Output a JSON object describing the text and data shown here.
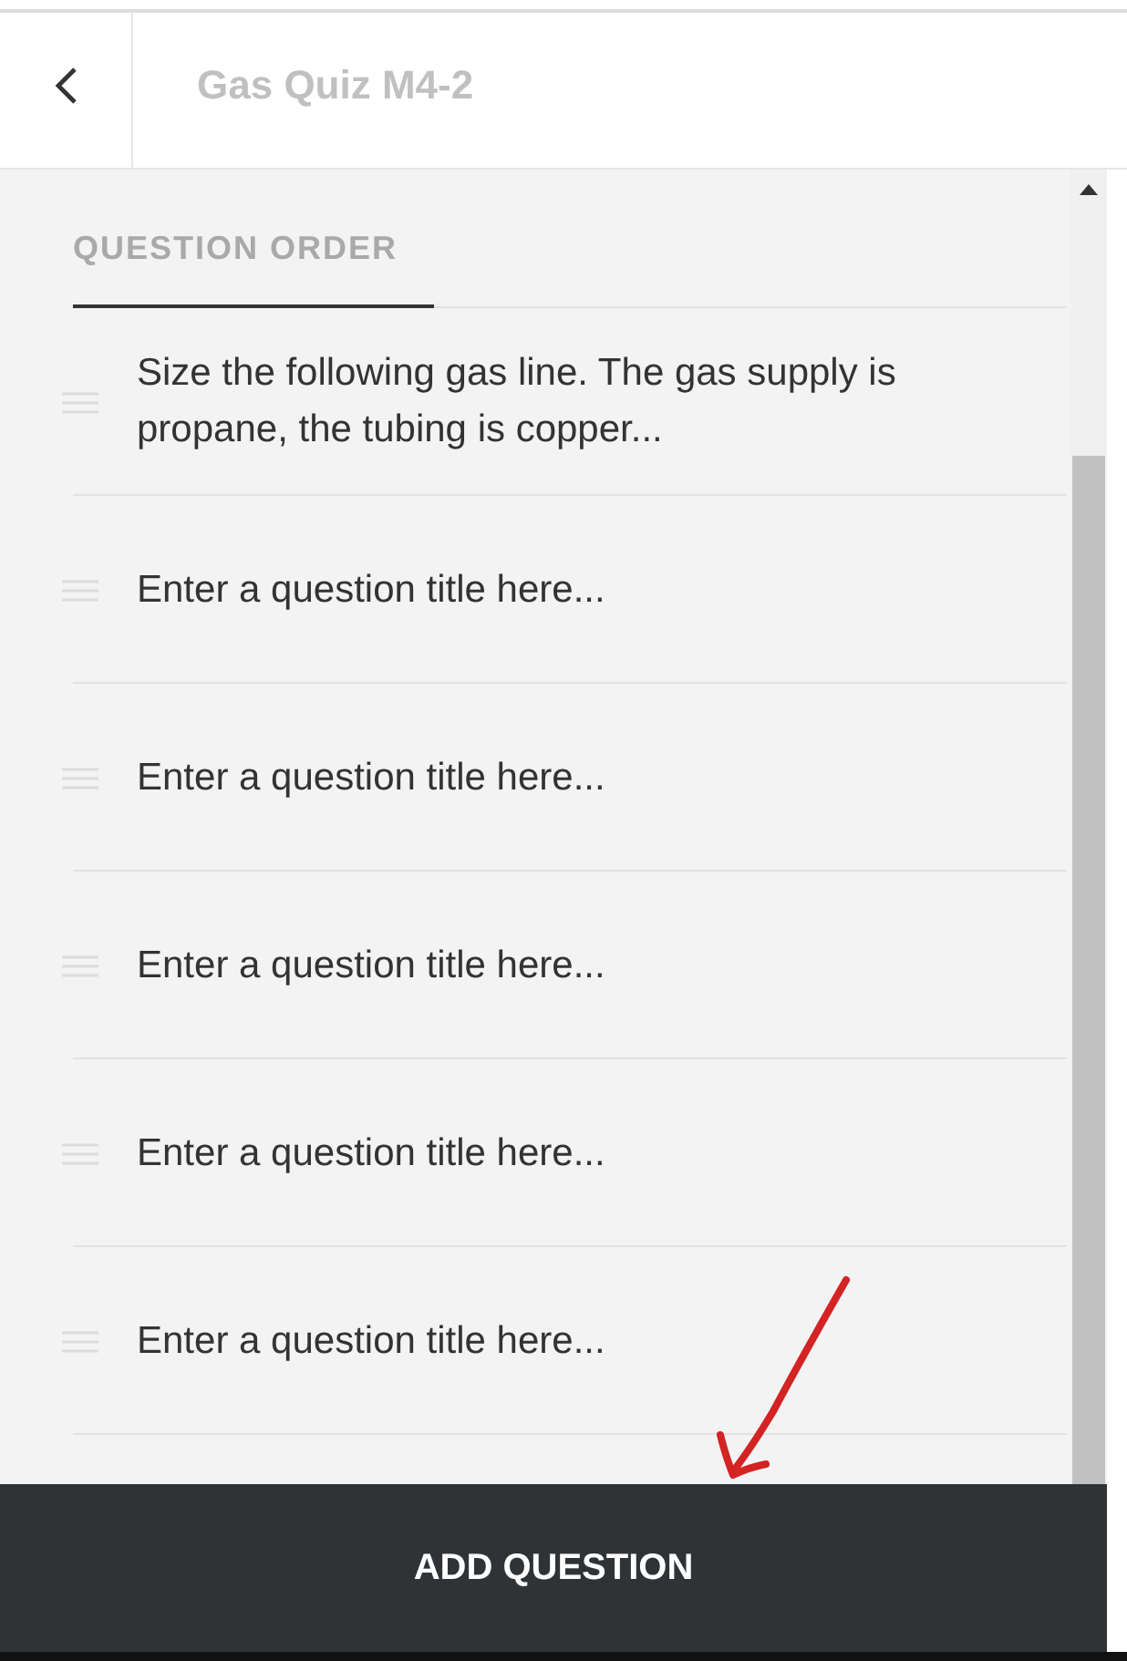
{
  "header": {
    "title": "Gas Quiz M4-2"
  },
  "section": {
    "heading": "QUESTION ORDER"
  },
  "questions": [
    {
      "title": "Size the following gas line. The gas supply is propane, the tubing is copper..."
    },
    {
      "title": "Enter a question title here..."
    },
    {
      "title": "Enter a question title here..."
    },
    {
      "title": "Enter a question title here..."
    },
    {
      "title": "Enter a question title here..."
    },
    {
      "title": "Enter a question title here..."
    }
  ],
  "button": {
    "label": "ADD QUESTION"
  }
}
